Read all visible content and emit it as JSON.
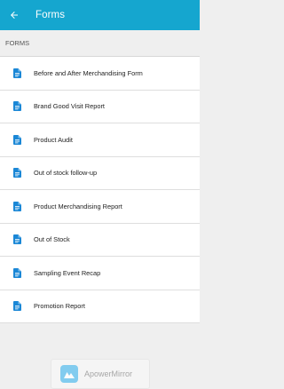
{
  "appbar": {
    "title": "Forms",
    "back_icon": "arrow-left-icon",
    "background": "#15a6cf"
  },
  "section": {
    "header": "FORMS"
  },
  "forms": [
    {
      "label": "Before and After Merchandising Form",
      "icon": "document-icon"
    },
    {
      "label": "Brand Good Visit Report",
      "icon": "document-icon"
    },
    {
      "label": "Product Audit",
      "icon": "document-icon"
    },
    {
      "label": "Out of stock follow-up",
      "icon": "document-icon"
    },
    {
      "label": "Product Merchandising Report",
      "icon": "document-icon"
    },
    {
      "label": "Out of Stock",
      "icon": "document-icon"
    },
    {
      "label": "Sampling Event Recap",
      "icon": "document-icon"
    },
    {
      "label": "Promotion Report",
      "icon": "document-icon"
    }
  ],
  "watermark": {
    "text": "ApowerMirror",
    "icon": "apowermirror-logo-icon"
  },
  "colors": {
    "icon_blue": "#1a87d6",
    "accent": "#15a6cf"
  }
}
